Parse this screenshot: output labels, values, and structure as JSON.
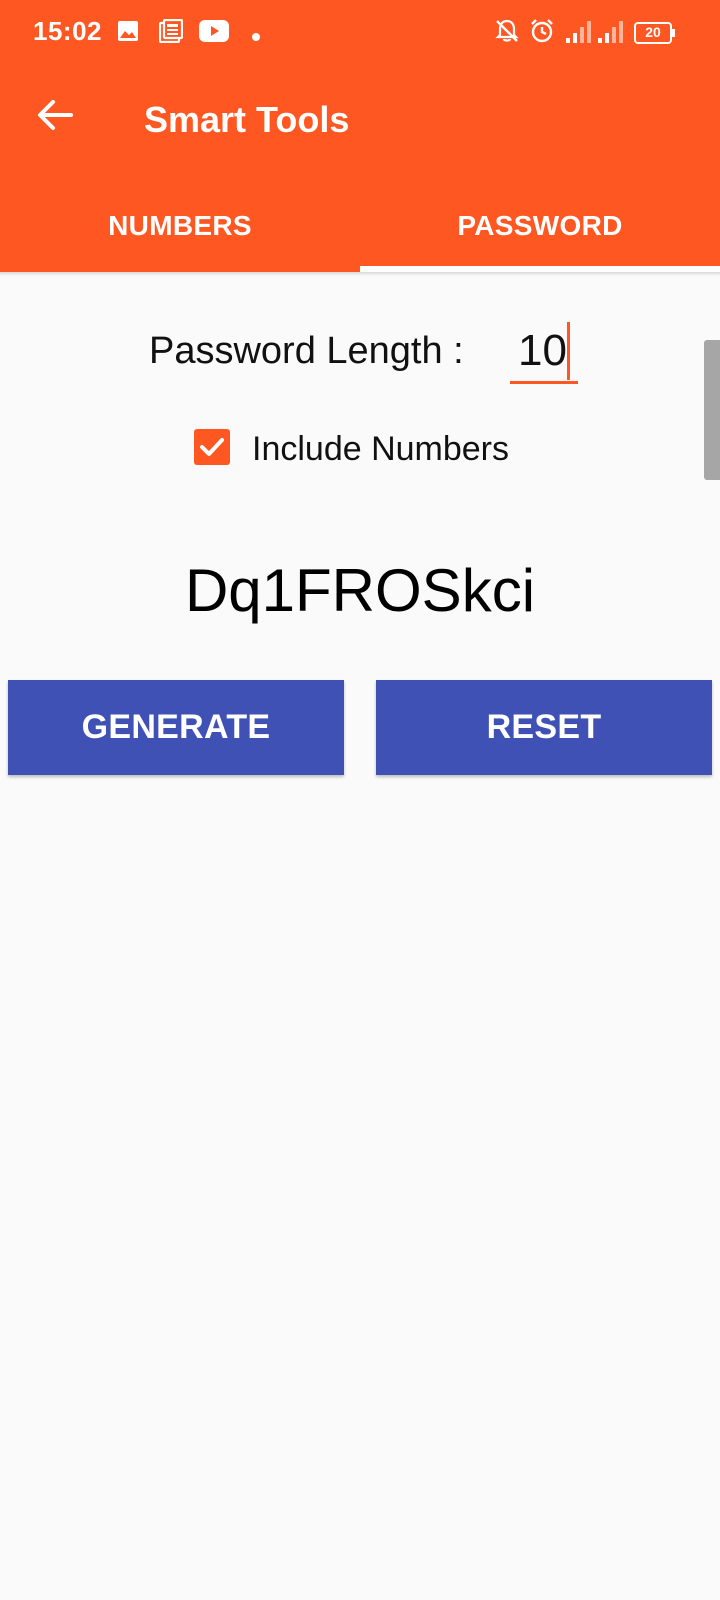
{
  "status_bar": {
    "time": "15:02",
    "battery_level": "20",
    "icons": [
      "image-icon",
      "news-icon",
      "youtube-icon",
      "dot-icon",
      "bell-off-icon",
      "alarm-icon",
      "signal-icon",
      "signal-icon",
      "battery-icon"
    ]
  },
  "toolbar": {
    "back_icon": "arrow-left-icon",
    "title": "Smart Tools"
  },
  "tabs": [
    {
      "label": "NUMBERS",
      "selected": false
    },
    {
      "label": "PASSWORD",
      "selected": true
    }
  ],
  "form": {
    "length_label": "Password Length :",
    "length_value": "10",
    "include_numbers_label": "Include Numbers",
    "include_numbers_checked": true
  },
  "result": {
    "password": "Dq1FROSkci"
  },
  "buttons": {
    "generate_label": "GENERATE",
    "reset_label": "RESET"
  },
  "colors": {
    "accent": "#ff5722",
    "button": "#3f51b5",
    "background": "#fafafa"
  }
}
